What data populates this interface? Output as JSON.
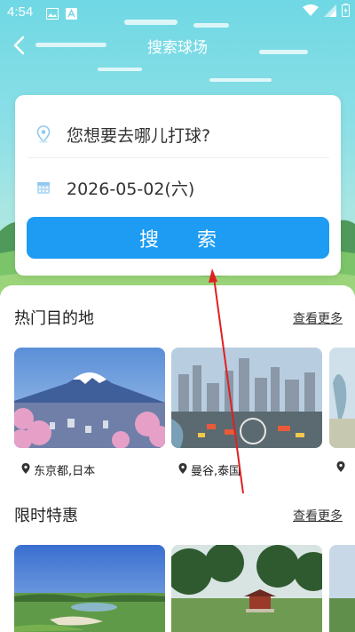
{
  "status_bar": {
    "time": "4:54"
  },
  "nav": {
    "title": "搜索球场"
  },
  "search": {
    "location_placeholder": "您想要去哪儿打球?",
    "date": "2026-05-02(六)",
    "button_label": "搜 索"
  },
  "sections": {
    "hot": {
      "title": "热门目的地",
      "more": "查看更多",
      "items": [
        {
          "location": "东京都,日本"
        },
        {
          "location": "曼谷,泰国"
        }
      ]
    },
    "deals": {
      "title": "限时特惠",
      "more": "查看更多"
    }
  },
  "colors": {
    "primary": "#1e9bf3",
    "sky": "#6fd8e4"
  }
}
